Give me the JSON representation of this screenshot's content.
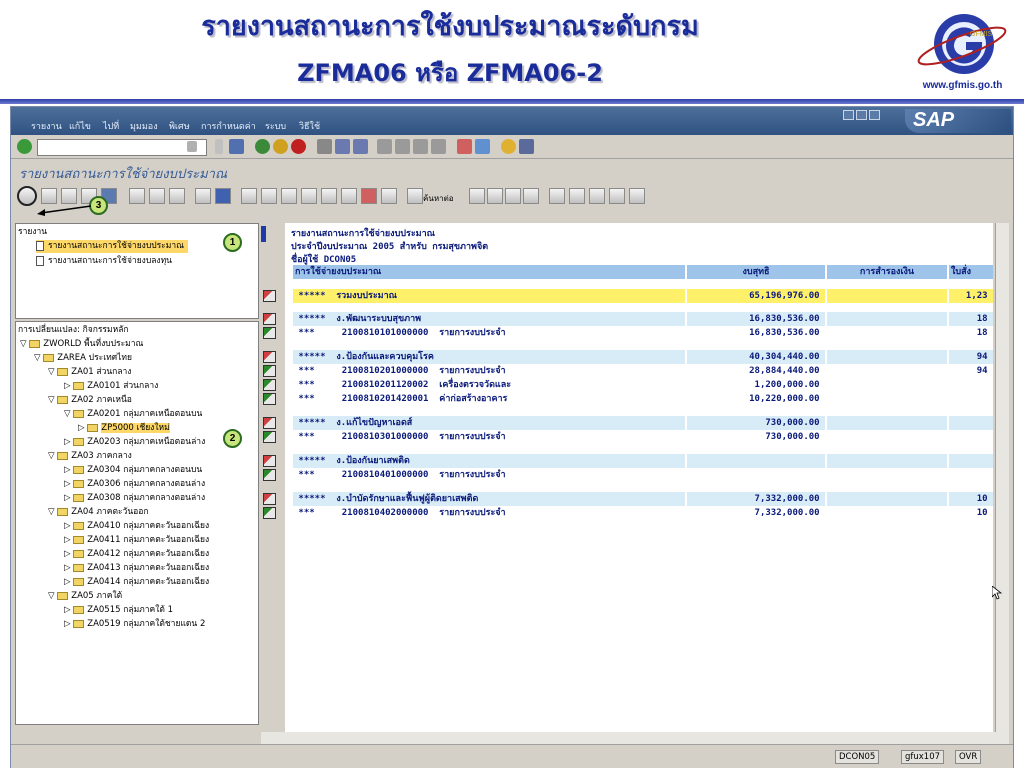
{
  "slide": {
    "title_line1": "รายงานสถานะการใช้งบประมาณระดับกรม",
    "title_line2": "ZFMA06 หรือ ZFMA06-2",
    "logo_text": "GFMIS",
    "logo_url": "www.gfmis.go.th"
  },
  "menubar": [
    "รายงาน",
    "แก้ไข",
    "ไปที่",
    "มุมมอง",
    "พิเศษ",
    "การกำหนดค่า",
    "ระบบ",
    "วิธีใช้"
  ],
  "sap_logo": "SAP",
  "screen_title": "รายงานสถานะการใช้จ่ายงบประมาณ",
  "toolbar2": {
    "find_label": "ค้นหาต่อ"
  },
  "left_top": {
    "header": "รายงาน",
    "items": [
      "รายงานสถานะการใช้จ่ายงบประมาณ",
      "รายงานสถานะการใช้จ่ายงบลงทุน"
    ]
  },
  "callouts": [
    "1",
    "2",
    "3"
  ],
  "tree": {
    "header": "การเปลี่ยนแปลง: กิจกรรมหลัก",
    "nodes": [
      "ZWORLD พื้นที่งบประมาณ",
      "ZAREA ประเทศไทย",
      "ZA01 ส่วนกลาง",
      "ZA0101 ส่วนกลาง",
      "ZA02 ภาคเหนือ",
      "ZA0201 กลุ่มภาคเหนือตอนบน",
      "ZP5000 เชียงใหม่",
      "ZA0203 กลุ่มภาคเหนือตอนล่าง",
      "ZA03 ภาคกลาง",
      "ZA0304 กลุ่มภาคกลางตอนบน",
      "ZA0306 กลุ่มภาคกลางตอนล่าง",
      "ZA0308 กลุ่มภาคกลางตอนล่าง",
      "ZA04 ภาคตะวันออก",
      "ZA0410 กลุ่มภาคตะวันออกเฉียง",
      "ZA0411 กลุ่มภาคตะวันออกเฉียง",
      "ZA0412 กลุ่มภาคตะวันออกเฉียง",
      "ZA0413 กลุ่มภาคตะวันออกเฉียง",
      "ZA0414 กลุ่มภาคตะวันออกเฉียง",
      "ZA05 ภาคใต้",
      "ZA0515 กลุ่มภาคใต้ 1",
      "ZA0519 กลุ่มภาคใต้ชายแดน 2"
    ]
  },
  "report": {
    "header_line1": "รายงานสถานะการใช้จ่ายงบประมาณ",
    "header_line2": "ประจำปีงบประมาณ 2005 สำหรับ กรมสุขภาพจิต",
    "header_line3": "ชื่อผู้ใช้ DCON05",
    "col_headers": [
      "การใช้จ่ายงบประมาณ",
      "งบสุทธิ",
      "การสำรองเงิน",
      "ใบสั่ง"
    ],
    "rows": [
      {
        "lvl": "*****",
        "code": "",
        "desc": "รวมงบประมาณ",
        "amount": "65,196,976.00",
        "po": "1,23",
        "style": "total"
      },
      {
        "lvl": "*****",
        "code": "",
        "desc": "ง.พัฒนาระบบสุขภาพ",
        "amount": "16,830,536.00",
        "po": "18",
        "style": "group"
      },
      {
        "lvl": "***",
        "code": "2100810101000000",
        "desc": "รายการงบประจำ",
        "amount": "16,830,536.00",
        "po": "18",
        "style": "item"
      },
      {
        "lvl": "*****",
        "code": "",
        "desc": "ง.ป้องกันและควบคุมโรค",
        "amount": "40,304,440.00",
        "po": "94",
        "style": "group"
      },
      {
        "lvl": "***",
        "code": "2100810201000000",
        "desc": "รายการงบประจำ",
        "amount": "28,884,440.00",
        "po": "94",
        "style": "item"
      },
      {
        "lvl": "***",
        "code": "2100810201120002",
        "desc": "เครื่องตรวจวัดและ",
        "amount": "1,200,000.00",
        "po": "",
        "style": "item"
      },
      {
        "lvl": "***",
        "code": "2100810201420001",
        "desc": "ค่าก่อสร้างอาคาร",
        "amount": "10,220,000.00",
        "po": "",
        "style": "item"
      },
      {
        "lvl": "*****",
        "code": "",
        "desc": "ง.แก้ไขปัญหาเอดส์",
        "amount": "730,000.00",
        "po": "",
        "style": "group"
      },
      {
        "lvl": "***",
        "code": "2100810301000000",
        "desc": "รายการงบประจำ",
        "amount": "730,000.00",
        "po": "",
        "style": "item"
      },
      {
        "lvl": "*****",
        "code": "",
        "desc": "ง.ป้องกันยาเสพติด",
        "amount": "",
        "po": "",
        "style": "group"
      },
      {
        "lvl": "***",
        "code": "2100810401000000",
        "desc": "รายการงบประจำ",
        "amount": "",
        "po": "",
        "style": "item"
      },
      {
        "lvl": "*****",
        "code": "",
        "desc": "ง.บำบัดรักษาและฟื้นฟูผู้ติดยาเสพติด",
        "amount": "7,332,000.00",
        "po": "10",
        "style": "group"
      },
      {
        "lvl": "***",
        "code": "2100810402000000",
        "desc": "รายการงบประจำ",
        "amount": "7,332,000.00",
        "po": "10",
        "style": "item"
      }
    ]
  },
  "statusbar": {
    "session": "DCON05",
    "server": "gfux107",
    "mode": "OVR"
  },
  "colors": {
    "accent_title": "#1a2c9a",
    "total_row": "#fff06a",
    "group_row": "#d8ecf8",
    "header_cell": "#9ec4ea",
    "sap_bar": "#2f5282"
  }
}
